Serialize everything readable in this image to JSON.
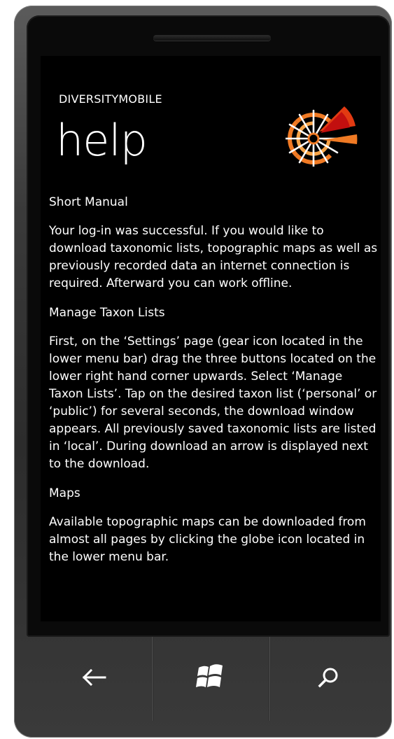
{
  "app": {
    "name": "DIVERSITYMOBILE",
    "page_title": "help"
  },
  "sections": [
    {
      "heading": "Short Manual",
      "text": "Your log-in was successful. If you would like to download taxonomic lists, topographic maps as well as previously recorded data an internet connection is required. Afterward you can work offline."
    },
    {
      "heading": "Manage Taxon Lists",
      "text": "First, on the ‘Settings’ page (gear icon located in the lower menu bar) drag the three buttons located on the lower right hand corner upwards. Select ‘Manage Taxon Lists’. Tap on the desired taxon list (‘personal’ or ‘public’) for several seconds, the download window appears. All previously saved taxonomic lists are listed in ‘local’. During download an arrow is displayed next to the download."
    },
    {
      "heading": "Maps",
      "text": "Available topographic maps can be downloaded from almost all pages by clicking the globe icon located in the lower menu bar."
    }
  ],
  "logo": {
    "icon": "diversitymobile-logo-icon",
    "colors": [
      "#e23a12",
      "#f07a24",
      "#f6a347",
      "#c20f0f"
    ]
  },
  "hardware_buttons": {
    "back_icon": "back-arrow-icon",
    "start_icon": "windows-start-icon",
    "search_icon": "search-icon"
  }
}
